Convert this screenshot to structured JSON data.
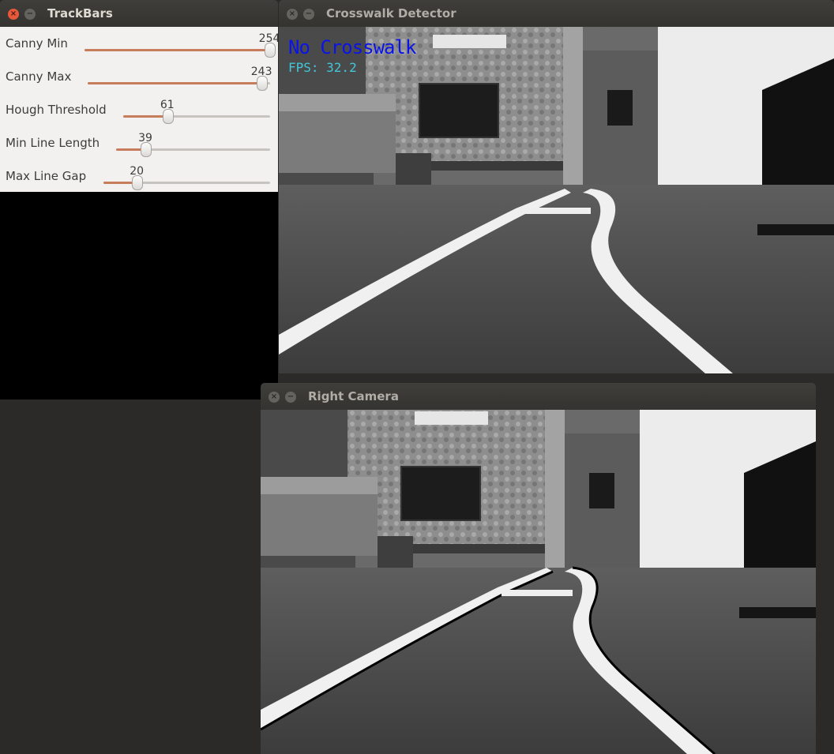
{
  "trackbars": {
    "title": "TrackBars",
    "controls": [
      {
        "label": "Canny Min",
        "value": "254",
        "fraction": 0.996
      },
      {
        "label": "Canny Max",
        "value": "243",
        "fraction": 0.953
      },
      {
        "label": "Hough Threshold",
        "value": "61",
        "fraction": 0.3
      },
      {
        "label": "Min Line Length",
        "value": "39",
        "fraction": 0.19
      },
      {
        "label": "Max Line Gap",
        "value": "20",
        "fraction": 0.2
      }
    ]
  },
  "crosswalk": {
    "title": "Crosswalk Detector",
    "status": "No Crosswalk",
    "fps": "FPS: 32.2"
  },
  "right_camera": {
    "title": "Right Camera"
  },
  "colors": {
    "slider_fill": "#c77d5b",
    "close_active": "#e7593a",
    "status_text": "#0a14e8",
    "fps_text": "#42c6d8"
  }
}
